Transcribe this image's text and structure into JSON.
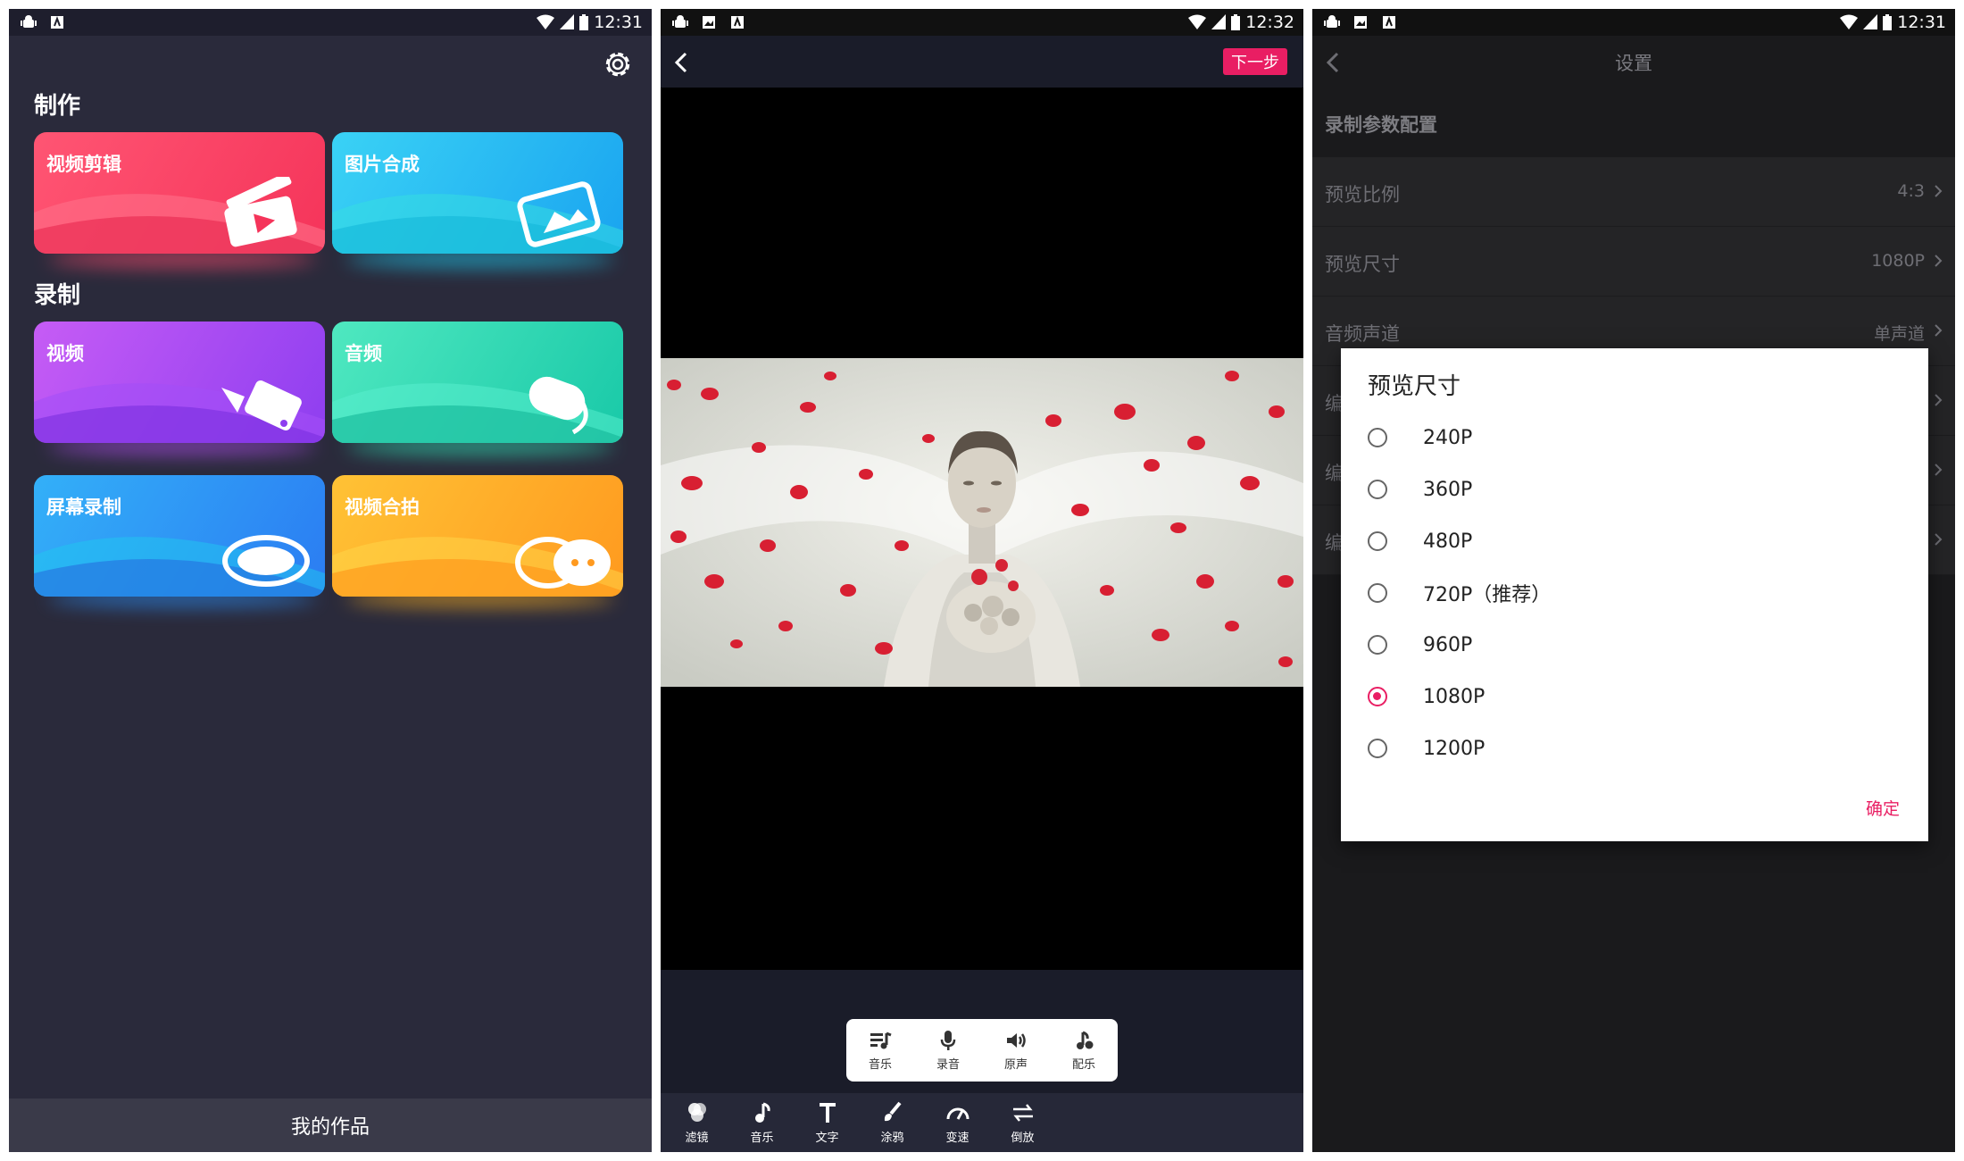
{
  "panel1": {
    "status_time": "12:31",
    "section_make": "制作",
    "section_record": "录制",
    "cards": [
      {
        "label": "视频剪辑",
        "icon": "clapperboard-icon"
      },
      {
        "label": "图片合成",
        "icon": "image-icon"
      },
      {
        "label": "视频",
        "icon": "video-camera-icon"
      },
      {
        "label": "音频",
        "icon": "microphone-icon"
      },
      {
        "label": "屏幕录制",
        "icon": "record-ring-icon"
      },
      {
        "label": "视频合拍",
        "icon": "duet-icon"
      }
    ],
    "bottom_label": "我的作品"
  },
  "panel2": {
    "status_time": "12:32",
    "next_label": "下一步",
    "audio_popup": [
      {
        "label": "音乐",
        "icon": "music-list-icon"
      },
      {
        "label": "录音",
        "icon": "mic-icon"
      },
      {
        "label": "原声",
        "icon": "speaker-icon"
      },
      {
        "label": "配乐",
        "icon": "note-plus-icon"
      }
    ],
    "tools": [
      {
        "label": "滤镜",
        "icon": "filter-icon"
      },
      {
        "label": "音乐",
        "icon": "music-note-icon"
      },
      {
        "label": "文字",
        "icon": "text-icon"
      },
      {
        "label": "涂鸦",
        "icon": "brush-icon"
      },
      {
        "label": "变速",
        "icon": "speedometer-icon"
      },
      {
        "label": "倒放",
        "icon": "reverse-icon"
      }
    ]
  },
  "panel3": {
    "status_time": "12:31",
    "title": "设置",
    "section": "录制参数配置",
    "rows": [
      {
        "label": "预览比例",
        "value": "4:3"
      },
      {
        "label": "预览尺寸",
        "value": "1080P"
      },
      {
        "label": "音频声道",
        "value": "单声道"
      },
      {
        "label": "编",
        "value": ""
      },
      {
        "label": "编",
        "value": ""
      },
      {
        "label": "编",
        "value": ""
      }
    ],
    "dialog": {
      "title": "预览尺寸",
      "options": [
        "240P",
        "360P",
        "480P",
        "720P（推荐）",
        "960P",
        "1080P",
        "1200P"
      ],
      "selected": "1080P",
      "ok_label": "确定"
    }
  },
  "colors": {
    "accent": "#e91e63"
  }
}
